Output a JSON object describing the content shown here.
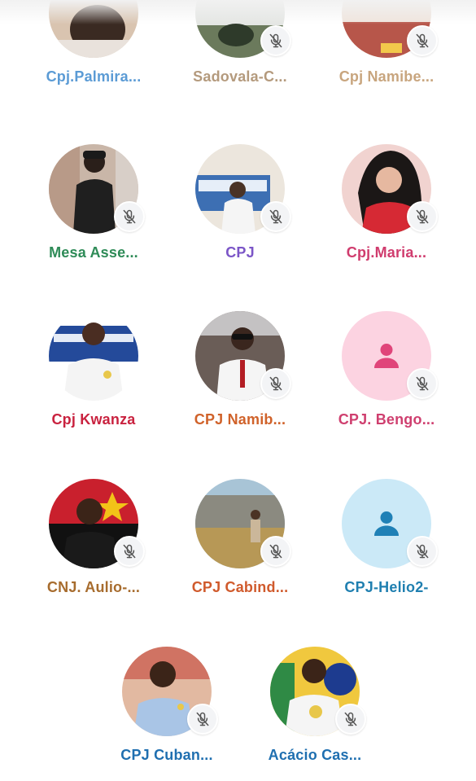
{
  "participants": [
    {
      "name": "Cpj.Palmira...",
      "color": "#5b9bd5",
      "avatar": "photo",
      "muted": true
    },
    {
      "name": "Sadovala-C...",
      "color": "#b49a7d",
      "avatar": "photo",
      "muted": true
    },
    {
      "name": "Cpj Namibe...",
      "color": "#c8a57e",
      "avatar": "photo",
      "muted": true
    },
    {
      "name": "Mesa Asse...",
      "color": "#2e8b57",
      "avatar": "photo",
      "muted": true
    },
    {
      "name": "CPJ",
      "color": "#7b55c7",
      "avatar": "photo",
      "muted": true
    },
    {
      "name": "Cpj.Maria...",
      "color": "#d03c6e",
      "avatar": "photo",
      "muted": true
    },
    {
      "name": "Cpj Kwanza",
      "color": "#c9223f",
      "avatar": "photo",
      "muted": false
    },
    {
      "name": "CPJ Namib...",
      "color": "#d0622a",
      "avatar": "photo",
      "muted": true
    },
    {
      "name": "CPJ. Bengo...",
      "color": "#cf3f6f",
      "avatar": "placeholder-pink",
      "muted": true
    },
    {
      "name": "CNJ. Aulio-...",
      "color": "#a76c2e",
      "avatar": "photo",
      "muted": true
    },
    {
      "name": "CPJ Cabind...",
      "color": "#d05a2c",
      "avatar": "photo",
      "muted": true
    },
    {
      "name": "CPJ-Helio2-",
      "color": "#1f7fb0",
      "avatar": "placeholder-blue",
      "muted": true
    },
    {
      "name": "CPJ Cuban...",
      "color": "#1f6fb0",
      "avatar": "photo",
      "muted": true
    },
    {
      "name": "Acácio Cas...",
      "color": "#1f6fb0",
      "avatar": "photo",
      "muted": true
    }
  ],
  "icons": {
    "mic_muted": "mic-off-icon",
    "person": "person-icon"
  },
  "colors": {
    "placeholder_pink_bg": "#fcd3e1",
    "placeholder_pink_fg": "#e0457a",
    "placeholder_blue_bg": "#cbe9f7",
    "placeholder_blue_fg": "#1f80b6",
    "badge_bg": "#f3f4f6",
    "mic_icon": "#555555"
  }
}
